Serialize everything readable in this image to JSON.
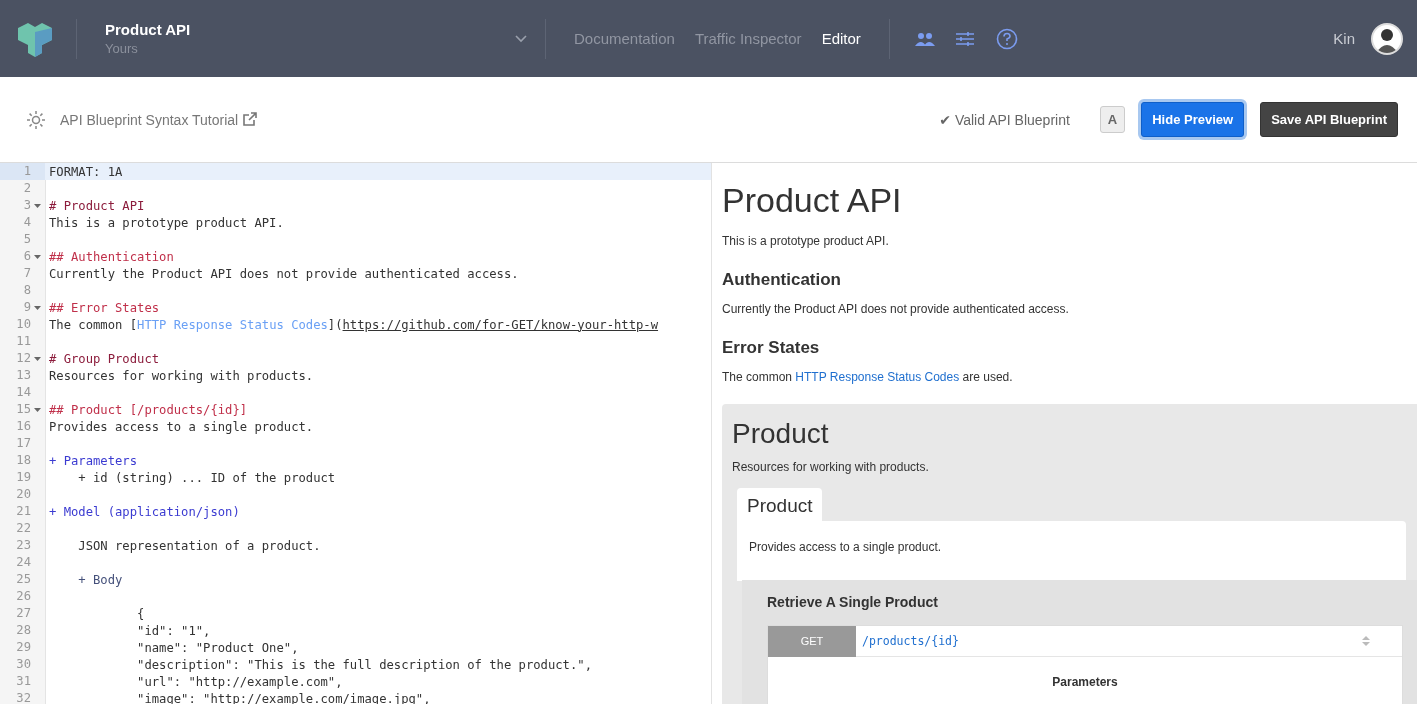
{
  "header": {
    "project_title": "Product API",
    "project_subtitle": "Yours",
    "nav": [
      {
        "label": "Documentation",
        "selected": false
      },
      {
        "label": "Traffic Inspector",
        "selected": false
      },
      {
        "label": "Editor",
        "selected": true
      }
    ],
    "user": "Kin"
  },
  "toolbar": {
    "tutorial_link": "API Blueprint Syntax Tutorial",
    "status": "Valid API Blueprint",
    "status_mark": "✔",
    "buttons": [
      {
        "label": "A",
        "kind": "toggle"
      },
      {
        "label": "Hide Preview",
        "kind": "primary"
      },
      {
        "label": "Save API Blueprint",
        "kind": "dark"
      }
    ]
  },
  "editor": {
    "lines": [
      {
        "number": "1",
        "foldable": false,
        "active": true,
        "tokens": [
          {
            "kind": "plain",
            "text": "FORMAT: 1A"
          }
        ]
      },
      {
        "number": "2",
        "foldable": false,
        "active": false
      },
      {
        "number": "3",
        "foldable": true,
        "active": false,
        "tokens": [
          {
            "kind": "h1",
            "text": "# Product API"
          }
        ]
      },
      {
        "number": "4",
        "foldable": false,
        "active": false,
        "tokens": [
          {
            "kind": "plain",
            "text": "This is a prototype product API."
          }
        ]
      },
      {
        "number": "5",
        "foldable": false,
        "active": false
      },
      {
        "number": "6",
        "foldable": true,
        "active": false,
        "tokens": [
          {
            "kind": "h2",
            "text": "## Authentication"
          }
        ]
      },
      {
        "number": "7",
        "foldable": false,
        "active": false,
        "tokens": [
          {
            "kind": "plain",
            "text": "Currently the Product API does not provide authenticated access."
          }
        ]
      },
      {
        "number": "8",
        "foldable": false,
        "active": false
      },
      {
        "number": "9",
        "foldable": true,
        "active": false,
        "tokens": [
          {
            "kind": "h2",
            "text": "## Error States"
          }
        ]
      },
      {
        "number": "10",
        "foldable": false,
        "active": false,
        "tokens": [
          {
            "kind": "plain",
            "text": "The common ["
          },
          {
            "kind": "link",
            "text": "HTTP Response Status Codes"
          },
          {
            "kind": "plain",
            "text": "]("
          },
          {
            "kind": "url",
            "text": "https://github.com/for-GET/know-your-http-w"
          }
        ]
      },
      {
        "number": "11",
        "foldable": false,
        "active": false
      },
      {
        "number": "12",
        "foldable": true,
        "active": false,
        "tokens": [
          {
            "kind": "h1",
            "text": "# Group Product"
          }
        ]
      },
      {
        "number": "13",
        "foldable": false,
        "active": false,
        "tokens": [
          {
            "kind": "plain",
            "text": "Resources for working with products."
          }
        ]
      },
      {
        "number": "14",
        "foldable": false,
        "active": false
      },
      {
        "number": "15",
        "foldable": true,
        "active": false,
        "tokens": [
          {
            "kind": "h2",
            "text": "## Product [/products/{id}]"
          }
        ]
      },
      {
        "number": "16",
        "foldable": false,
        "active": false,
        "tokens": [
          {
            "kind": "plain",
            "text": "Provides access to a single product."
          }
        ]
      },
      {
        "number": "17",
        "foldable": false,
        "active": false
      },
      {
        "number": "18",
        "foldable": false,
        "active": false,
        "tokens": [
          {
            "kind": "section",
            "text": "+ Parameters"
          }
        ]
      },
      {
        "number": "19",
        "foldable": false,
        "active": false,
        "tokens": [
          {
            "kind": "plain",
            "text": "    + id (string) ... ID of the product"
          }
        ]
      },
      {
        "number": "20",
        "foldable": false,
        "active": false
      },
      {
        "number": "21",
        "foldable": false,
        "active": false,
        "tokens": [
          {
            "kind": "section",
            "text": "+ Model (application/json)"
          }
        ]
      },
      {
        "number": "22",
        "foldable": false,
        "active": false
      },
      {
        "number": "23",
        "foldable": false,
        "active": false,
        "tokens": [
          {
            "kind": "plain",
            "text": "    JSON representation of a product."
          }
        ]
      },
      {
        "number": "24",
        "foldable": false,
        "active": false
      },
      {
        "number": "25",
        "foldable": false,
        "active": false,
        "tokens": [
          {
            "kind": "subsection",
            "text": "    + Body"
          }
        ]
      },
      {
        "number": "26",
        "foldable": false,
        "active": false
      },
      {
        "number": "27",
        "foldable": false,
        "active": false,
        "tokens": [
          {
            "kind": "plain",
            "text": "            {"
          }
        ]
      },
      {
        "number": "28",
        "foldable": false,
        "active": false,
        "tokens": [
          {
            "kind": "plain",
            "text": "            \"id\": \"1\","
          }
        ]
      },
      {
        "number": "29",
        "foldable": false,
        "active": false,
        "tokens": [
          {
            "kind": "plain",
            "text": "            \"name\": \"Product One\","
          }
        ]
      },
      {
        "number": "30",
        "foldable": false,
        "active": false,
        "tokens": [
          {
            "kind": "plain",
            "text": "            \"description\": \"This is the full description of the product.\","
          }
        ]
      },
      {
        "number": "31",
        "foldable": false,
        "active": false,
        "tokens": [
          {
            "kind": "plain",
            "text": "            \"url\": \"http://example.com\","
          }
        ]
      },
      {
        "number": "32",
        "foldable": false,
        "active": false,
        "tokens": [
          {
            "kind": "plain",
            "text": "            \"image\": \"http://example.com/image.jpg\","
          }
        ]
      }
    ]
  },
  "preview": {
    "title": "Product API",
    "intro": "This is a prototype product API.",
    "sections": [
      {
        "heading": "Authentication",
        "text": "Currently the Product API does not provide authenticated access."
      },
      {
        "heading": "Error States",
        "text_before": "The common ",
        "link": "HTTP Response Status Codes",
        "text_after": " are used."
      }
    ],
    "group": {
      "title": "Product",
      "description": "Resources for working with products.",
      "resource": {
        "tab": "Product",
        "description": "Provides access to a single product.",
        "action": {
          "title": "Retrieve A Single Product",
          "method": "GET",
          "path": "/products/{id}",
          "parameters_heading": "Parameters"
        }
      }
    }
  }
}
